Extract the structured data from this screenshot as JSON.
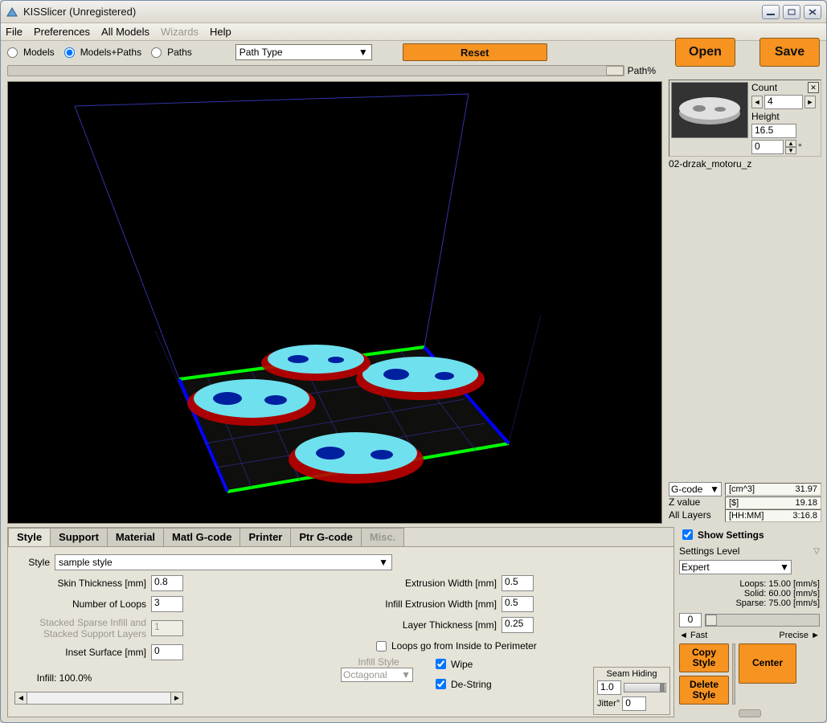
{
  "window": {
    "title": "KISSlicer (Unregistered)"
  },
  "menu": [
    "File",
    "Preferences",
    "All Models",
    "Wizards",
    "Help"
  ],
  "menu_disabled_index": 3,
  "viewmodes": [
    "Models",
    "Models+Paths",
    "Paths"
  ],
  "viewmode_selected": 1,
  "pathtype_label": "Path Type",
  "reset_label": "Reset",
  "open_label": "Open",
  "save_label": "Save",
  "path_pct_label": "Path%",
  "model": {
    "name": "02-drzak_motoru_z",
    "count_label": "Count",
    "count_value": "4",
    "height_label": "Height",
    "height_value": "16.5",
    "rotation_value": "0",
    "rotation_unit": "°"
  },
  "gcode_select": "G-code",
  "z_value_label": "Z value",
  "all_layers_label": "All Layers",
  "estimates": {
    "volume_label": "[cm^3]",
    "volume_value": "31.97",
    "cost_label": "[$]",
    "cost_value": "19.18",
    "time_label": "[HH:MM]",
    "time_value": "3:16.8"
  },
  "tabs": [
    "Style",
    "Support",
    "Material",
    "Matl G-code",
    "Printer",
    "Ptr G-code",
    "Misc."
  ],
  "tab_active_index": 0,
  "tab_disabled_index": 6,
  "style": {
    "style_label": "Style",
    "style_value": "sample style",
    "skin_thickness_label": "Skin Thickness [mm]",
    "skin_thickness_value": "0.8",
    "num_loops_label": "Number of Loops",
    "num_loops_value": "3",
    "stacked_label1": "Stacked Sparse Infill and",
    "stacked_label2": "Stacked Support Layers",
    "stacked_value": "1",
    "inset_label": "Inset  Surface [mm]",
    "inset_value": "0",
    "extrusion_width_label": "Extrusion Width [mm]",
    "extrusion_width_value": "0.5",
    "infill_extrusion_width_label": "Infill Extrusion Width [mm]",
    "infill_extrusion_width_value": "0.5",
    "layer_thickness_label": "Layer Thickness [mm]",
    "layer_thickness_value": "0.25",
    "loops_inside_label": "Loops go from Inside to Perimeter",
    "wipe_label": "Wipe",
    "destring_label": "De-String",
    "infill_label": "Infill: 100.0%",
    "infill_style_label": "Infill Style",
    "infill_style_value": "Octagonal",
    "seam_hiding_label": "Seam Hiding",
    "seam_value": "1.0",
    "jitter_label": "Jitter°",
    "jitter_value": "0"
  },
  "settings": {
    "show_settings_label": "Show Settings",
    "settings_level_label": "Settings Level",
    "settings_level_value": "Expert",
    "loops_speed": "Loops: 15.00 [mm/s]",
    "solid_speed": "Solid: 60.00 [mm/s]",
    "sparse_speed": "Sparse: 75.00 [mm/s]",
    "fp_value": "0",
    "fast_label": "Fast",
    "precise_label": "Precise",
    "copy_style": "Copy Style",
    "delete_style": "Delete Style",
    "center": "Center"
  }
}
